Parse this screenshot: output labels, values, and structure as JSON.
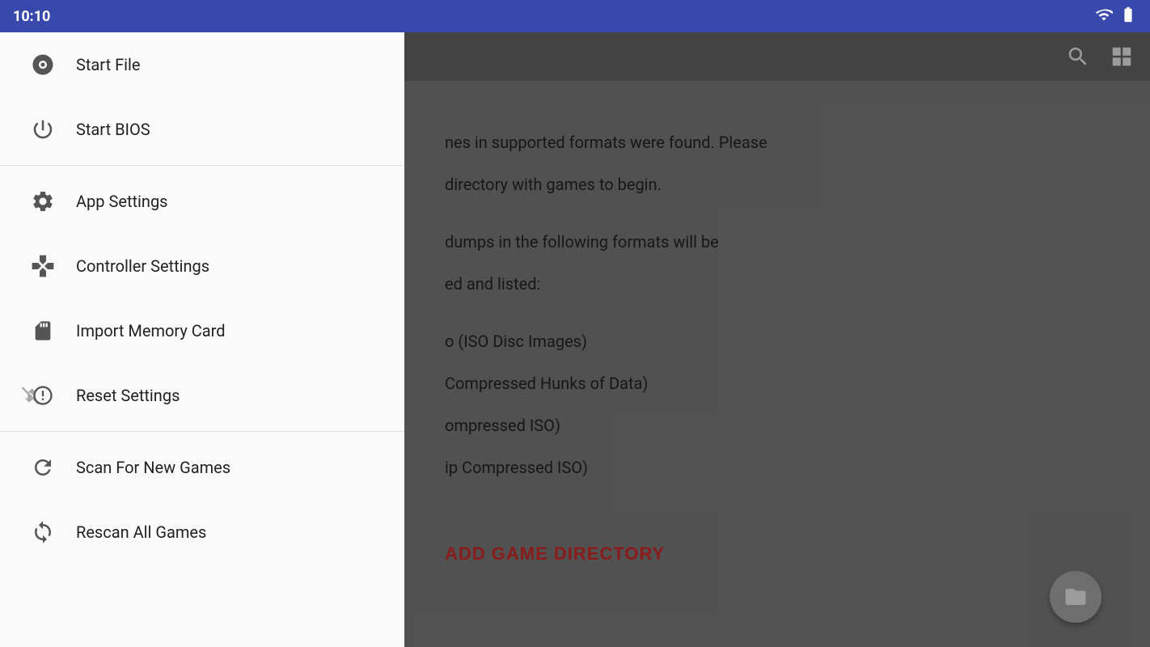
{
  "statusBar": {
    "time": "10:10",
    "wifiIcon": "wifi",
    "batteryIcon": "battery"
  },
  "toolbar": {
    "searchIcon": "search",
    "gridIcon": "grid"
  },
  "main": {
    "noGamesText1": "nes in supported formats were found. Please",
    "noGamesText2": "directory with games to begin.",
    "noGamesText3": "dumps in the following formats will be",
    "noGamesText4": "ed and listed:",
    "format1": "o (ISO Disc Images)",
    "format2": "Compressed Hunks of Data)",
    "format3": "ompressed ISO)",
    "format4": "ip Compressed ISO)",
    "addGameBtn": "ADD GAME DIRECTORY",
    "fabIcon": "folder"
  },
  "sidebar": {
    "items": [
      {
        "id": "start-file",
        "label": "Start File",
        "icon": "disc"
      },
      {
        "id": "start-bios",
        "label": "Start BIOS",
        "icon": "power"
      },
      {
        "id": "app-settings",
        "label": "App Settings",
        "icon": "settings"
      },
      {
        "id": "controller-settings",
        "label": "Controller Settings",
        "icon": "controller"
      },
      {
        "id": "import-memory-card",
        "label": "Import Memory Card",
        "icon": "memory-card"
      },
      {
        "id": "reset-settings",
        "label": "Reset Settings",
        "icon": "reset"
      },
      {
        "id": "scan-for-new-games",
        "label": "Scan For New Games",
        "icon": "refresh"
      },
      {
        "id": "rescan-all-games",
        "label": "Rescan All Games",
        "icon": "rescan"
      }
    ]
  }
}
